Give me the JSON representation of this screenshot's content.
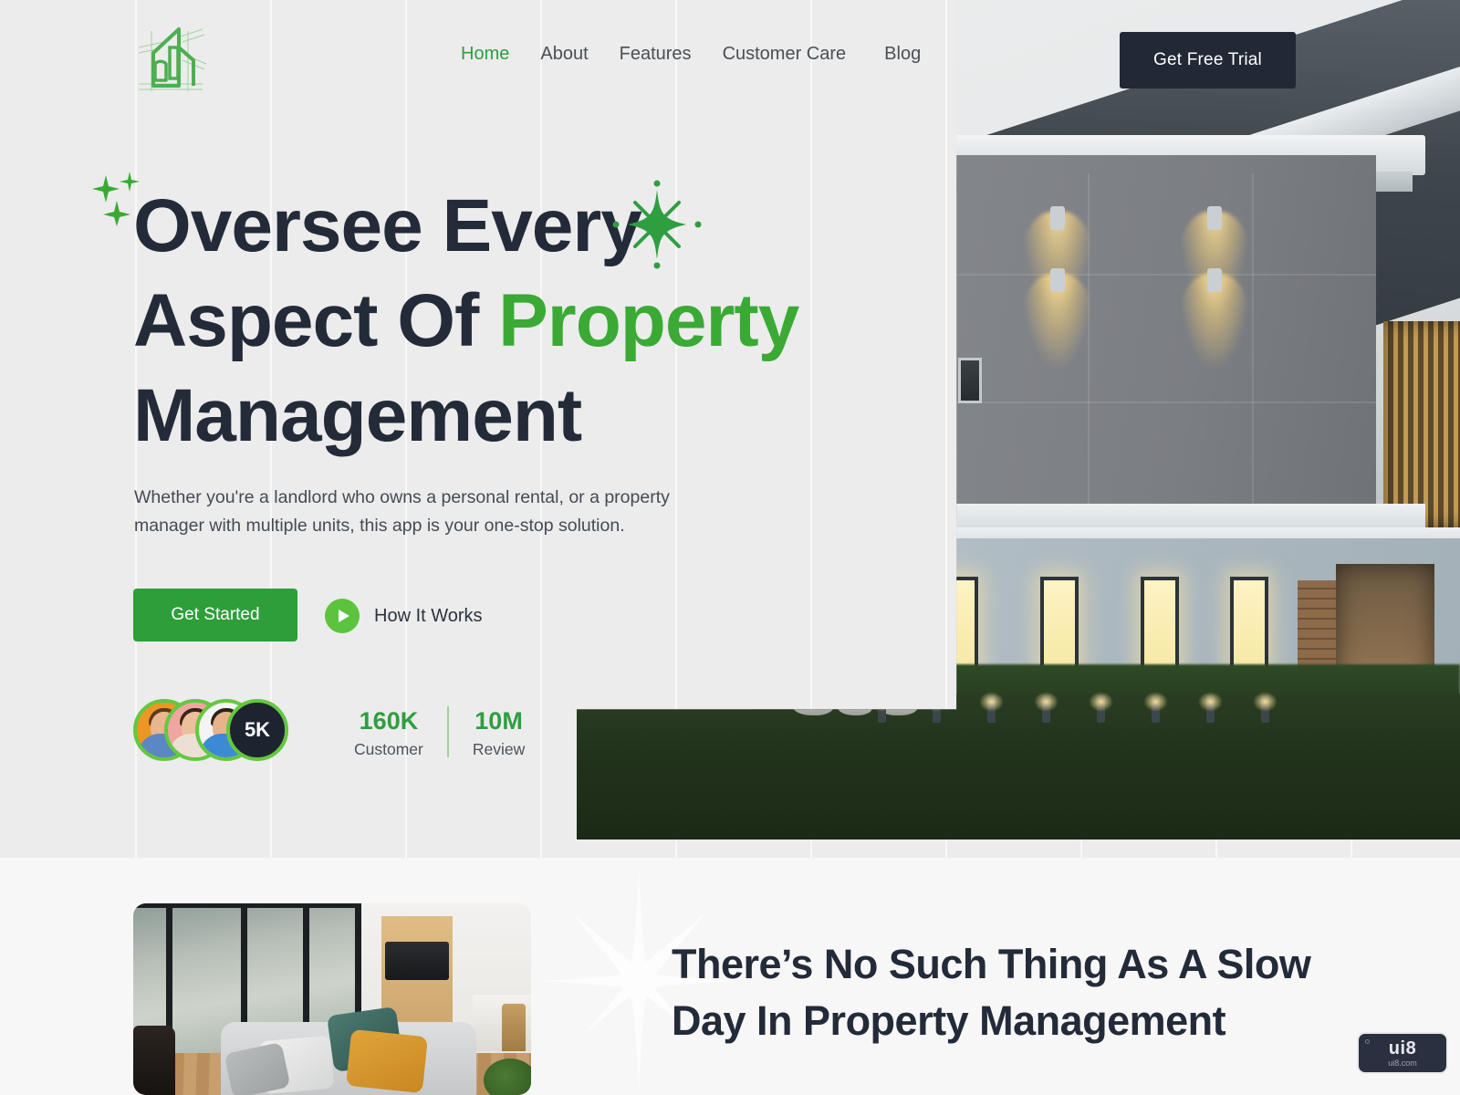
{
  "brand": {
    "logo_icon": "building-logo-icon"
  },
  "nav": {
    "items": [
      {
        "label": "Home",
        "active": true
      },
      {
        "label": "About",
        "active": false
      },
      {
        "label": "Features",
        "active": false
      },
      {
        "label": "Customer Care",
        "active": false
      },
      {
        "label": "Blog",
        "active": false
      }
    ],
    "cta_label": "Get Free Trial"
  },
  "hero": {
    "headline_line1": "Oversee Every",
    "headline_line2_plain": "Aspect Of ",
    "headline_line2_accent": "Property",
    "headline_line3": "Management",
    "paragraph": "Whether you're a landlord who owns a personal rental, or a property manager with multiple units, this app is your one-stop solution.",
    "primary_cta": "Get Started",
    "secondary_cta": "How It Works",
    "secondary_cta_icon": "play-icon",
    "sparkle_icon": "sparkle-icon",
    "star_icon": "four-point-star-icon",
    "social_proof": {
      "avatar_count_badge": "5K",
      "avatars": [
        "avatar-1",
        "avatar-2",
        "avatar-3"
      ],
      "stats": [
        {
          "value": "160K",
          "label": "Customer"
        },
        {
          "value": "10M",
          "label": "Review"
        }
      ]
    },
    "image_alt": "modern-house-exterior-photo"
  },
  "section2": {
    "title": "There’s No Such Thing As A Slow Day In Property Management",
    "image_alt": "living-room-interior-photo",
    "burst_icon": "starburst-icon"
  },
  "watermark": {
    "main": "ui8",
    "sub": "ui8.com"
  },
  "colors": {
    "accent_green": "#2f9e41",
    "bright_green": "#3aaa35",
    "button_green": "#2e9e3a",
    "play_green": "#5bc33e",
    "dark": "#212936",
    "hero_bg": "#ececec",
    "section_bg": "#f7f7f7"
  }
}
